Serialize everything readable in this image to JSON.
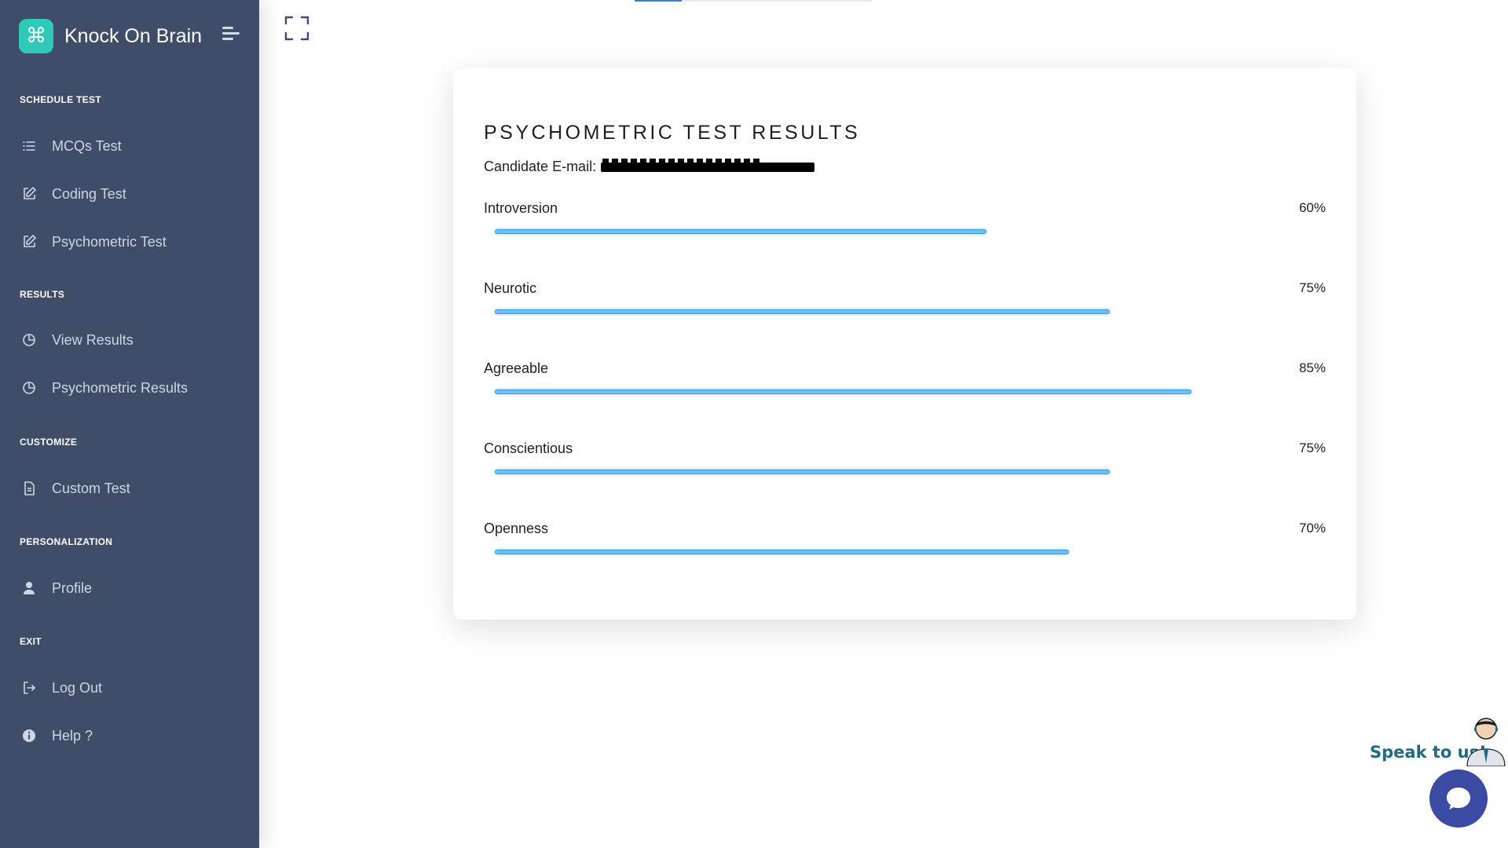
{
  "brand": {
    "name": "Knock On Brain"
  },
  "sidebar": {
    "sections": [
      {
        "label": "SCHEDULE TEST"
      },
      {
        "label": "RESULTS"
      },
      {
        "label": "CUSTOMIZE"
      },
      {
        "label": "PERSONALIZATION"
      },
      {
        "label": "EXIT"
      }
    ],
    "items": [
      {
        "label": "MCQs Test",
        "icon": "list-icon"
      },
      {
        "label": "Coding Test",
        "icon": "edit-icon"
      },
      {
        "label": "Psychometric Test",
        "icon": "edit-icon"
      },
      {
        "label": "View Results",
        "icon": "pie-chart-icon"
      },
      {
        "label": "Psychometric Results",
        "icon": "pie-chart-icon"
      },
      {
        "label": "Custom Test",
        "icon": "document-icon"
      },
      {
        "label": "Profile",
        "icon": "user-icon"
      },
      {
        "label": "Log Out",
        "icon": "logout-icon"
      },
      {
        "label": "Help ?",
        "icon": "info-icon"
      }
    ]
  },
  "card": {
    "title": "PSYCHOMETRIC TEST RESULTS",
    "candidate_label": "Candidate E-mail:",
    "metrics": [
      {
        "label": "Introversion",
        "value_text": "60%",
        "value": 60
      },
      {
        "label": "Neurotic",
        "value_text": "75%",
        "value": 75
      },
      {
        "label": "Agreeable",
        "value_text": "85%",
        "value": 85
      },
      {
        "label": "Conscientious",
        "value_text": "75%",
        "value": 75
      },
      {
        "label": "Openness",
        "value_text": "70%",
        "value": 70
      }
    ]
  },
  "chat": {
    "label": "Speak to us!"
  },
  "colors": {
    "sidebar_bg": "#3f4d69",
    "brand_accent": "#2ec9b7",
    "progress_fill": "#6fc0f2",
    "chat_button": "#3b4aa2",
    "chat_label": "#1f6a86"
  }
}
